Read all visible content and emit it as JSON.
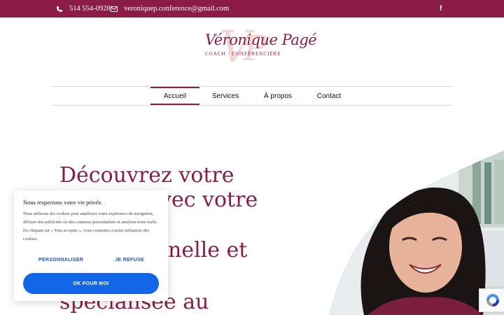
{
  "topbar": {
    "phone": "514 554-0928",
    "email": "veroniquep.conference@gmail.com",
    "facebook": "f",
    "bg_color": "#8a1c45"
  },
  "logo": {
    "name": "Véronique Pagé",
    "tagline": "COACH · CONFÉRENCIÈRE"
  },
  "nav": {
    "items": [
      {
        "label": "Accueil",
        "active": true
      },
      {
        "label": "Services",
        "active": false
      },
      {
        "label": "À propos",
        "active": false
      },
      {
        "label": "Contact",
        "active": false
      }
    ]
  },
  "hero": {
    "line1": "Découvrez votre",
    "line2": "vec votre",
    "line3": "nelle et",
    "line4": "spécialisée au"
  },
  "cookie": {
    "title": "Nous respectons votre vie privée.",
    "body": "Nous utilisons des cookies pour améliorer votre expérience de navigation, diffuser des publicités ou des contenus personnalisés et analyser notre trafic. En cliquant sur « Tout accepter », vous consentez à notre utilisation des cookies.",
    "customize_label": "PERSONNALISER",
    "refuse_label": "JE REFUSE",
    "accept_label": "OK POUR MOI",
    "accept_color": "#1466e8"
  },
  "colors": {
    "accent": "#8a1c45"
  }
}
